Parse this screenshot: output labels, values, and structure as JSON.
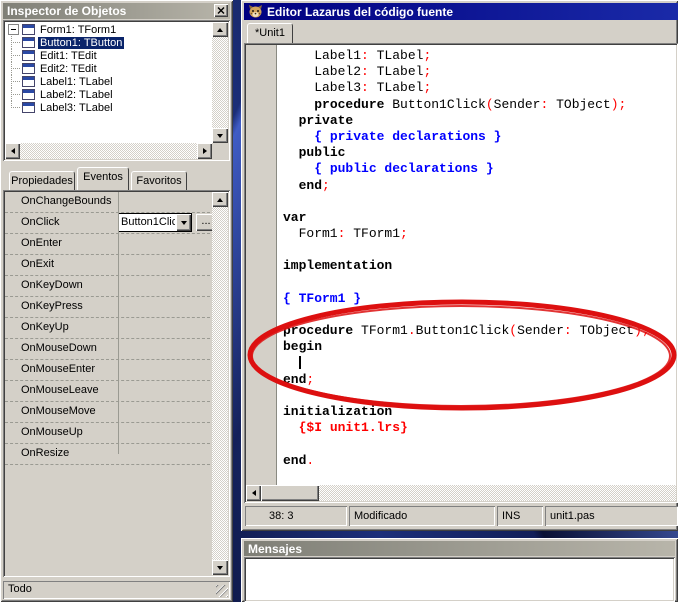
{
  "colors": {
    "button_face": "#D4D0C8",
    "selection": "#0A246A",
    "titlebar_active": "#000080",
    "titlebar_inactive": "#7F7F76",
    "syntax_keyword": "#000000",
    "syntax_symbol": "#FF0000",
    "syntax_comment": "#0000FF",
    "syntax_directive": "#FF0000",
    "annotation": "#DD1010"
  },
  "icons": {
    "window_close": "x-cross",
    "lazarus_logo": "cheetah-head",
    "combo_dropdown": "triangle-down",
    "scroll_up": "triangle-up",
    "scroll_down": "triangle-down",
    "scroll_left": "triangle-left",
    "scroll_right": "triangle-right",
    "tree_collapse": "minus-box",
    "component": "mini-window"
  },
  "inspector": {
    "title": "Inspector de Objetos",
    "tree_items": [
      {
        "label": "Form1: TForm1",
        "root": true,
        "selected": false
      },
      {
        "label": "Button1: TButton",
        "root": false,
        "selected": true
      },
      {
        "label": "Edit1: TEdit",
        "root": false,
        "selected": false
      },
      {
        "label": "Edit2: TEdit",
        "root": false,
        "selected": false
      },
      {
        "label": "Label1: TLabel",
        "root": false,
        "selected": false
      },
      {
        "label": "Label2: TLabel",
        "root": false,
        "selected": false
      },
      {
        "label": "Label3: TLabel",
        "root": false,
        "selected": false
      }
    ],
    "tabs": [
      {
        "label": "Propiedades",
        "active": false
      },
      {
        "label": "Eventos",
        "active": true
      },
      {
        "label": "Favoritos",
        "active": false
      }
    ],
    "events": [
      {
        "name": "OnChangeBounds",
        "value": "",
        "has_editor": false
      },
      {
        "name": "OnClick",
        "value": "Button1Clic",
        "has_editor": true
      },
      {
        "name": "OnEnter",
        "value": "",
        "has_editor": false
      },
      {
        "name": "OnExit",
        "value": "",
        "has_editor": false
      },
      {
        "name": "OnKeyDown",
        "value": "",
        "has_editor": false
      },
      {
        "name": "OnKeyPress",
        "value": "",
        "has_editor": false
      },
      {
        "name": "OnKeyUp",
        "value": "",
        "has_editor": false
      },
      {
        "name": "OnMouseDown",
        "value": "",
        "has_editor": false
      },
      {
        "name": "OnMouseEnter",
        "value": "",
        "has_editor": false
      },
      {
        "name": "OnMouseLeave",
        "value": "",
        "has_editor": false
      },
      {
        "name": "OnMouseMove",
        "value": "",
        "has_editor": false
      },
      {
        "name": "OnMouseUp",
        "value": "",
        "has_editor": false
      },
      {
        "name": "OnResize",
        "value": "",
        "has_editor": false
      }
    ],
    "editor_button_label": "...",
    "status": "Todo"
  },
  "editor": {
    "title": "Editor Lazarus del código fuente",
    "tabs": [
      {
        "label": "*Unit1",
        "active": true
      }
    ],
    "status": {
      "cursor": "38: 3",
      "state": "Modificado",
      "mode": "INS",
      "file": "unit1.pas"
    },
    "code": {
      "cursor_line": 20,
      "lines": [
        [
          [
            "i",
            "    Label1"
          ],
          [
            "s",
            ":"
          ],
          [
            "i",
            " TLabel"
          ],
          [
            "s",
            ";"
          ]
        ],
        [
          [
            "i",
            "    Label2"
          ],
          [
            "s",
            ":"
          ],
          [
            "i",
            " TLabel"
          ],
          [
            "s",
            ";"
          ]
        ],
        [
          [
            "i",
            "    Label3"
          ],
          [
            "s",
            ":"
          ],
          [
            "i",
            " TLabel"
          ],
          [
            "s",
            ";"
          ]
        ],
        [
          [
            "i",
            "    "
          ],
          [
            "k",
            "procedure"
          ],
          [
            "i",
            " Button1Click"
          ],
          [
            "s",
            "("
          ],
          [
            "i",
            "Sender"
          ],
          [
            "s",
            ":"
          ],
          [
            "i",
            " TObject"
          ],
          [
            "s",
            ");"
          ]
        ],
        [
          [
            "i",
            "  "
          ],
          [
            "k",
            "private"
          ]
        ],
        [
          [
            "i",
            "    "
          ],
          [
            "c",
            "{ private declarations }"
          ]
        ],
        [
          [
            "i",
            "  "
          ],
          [
            "k",
            "public"
          ]
        ],
        [
          [
            "i",
            "    "
          ],
          [
            "c",
            "{ public declarations }"
          ]
        ],
        [
          [
            "i",
            "  "
          ],
          [
            "k",
            "end"
          ],
          [
            "s",
            ";"
          ]
        ],
        [],
        [
          [
            "k",
            "var"
          ]
        ],
        [
          [
            "i",
            "  Form1"
          ],
          [
            "s",
            ":"
          ],
          [
            "i",
            " TForm1"
          ],
          [
            "s",
            ";"
          ]
        ],
        [],
        [
          [
            "k",
            "implementation"
          ]
        ],
        [],
        [
          [
            "c",
            "{ TForm1 }"
          ]
        ],
        [],
        [
          [
            "k",
            "procedure"
          ],
          [
            "i",
            " TForm1"
          ],
          [
            "s",
            "."
          ],
          [
            "i",
            "Button1Click"
          ],
          [
            "s",
            "("
          ],
          [
            "i",
            "Sender"
          ],
          [
            "s",
            ":"
          ],
          [
            "i",
            " TObject"
          ],
          [
            "s",
            ");"
          ]
        ],
        [
          [
            "k",
            "begin"
          ]
        ],
        [
          [
            "i",
            "  "
          ]
        ],
        [
          [
            "k",
            "end"
          ],
          [
            "s",
            ";"
          ]
        ],
        [],
        [
          [
            "k",
            "initialization"
          ]
        ],
        [
          [
            "i",
            "  "
          ],
          [
            "d",
            "{$I unit1.lrs}"
          ]
        ],
        [],
        [
          [
            "k",
            "end"
          ],
          [
            "s",
            "."
          ]
        ]
      ]
    }
  },
  "messages": {
    "title": "Mensajes"
  },
  "annotation": {
    "type": "ellipse",
    "color": "#DD1010"
  }
}
